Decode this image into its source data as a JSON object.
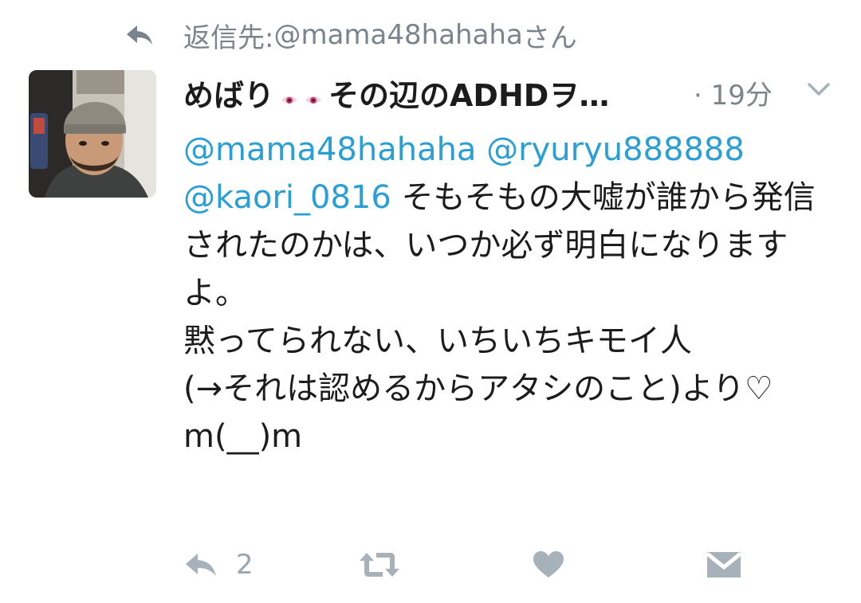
{
  "reply_context": {
    "label": "返信先: ",
    "handle": "@mama48hahaha",
    "suffix": "さん"
  },
  "tweet": {
    "display_name_before": "めばり",
    "display_name_after": "その辺のADHDヲ…",
    "timestamp": "· 19分",
    "mentions_line1": "@mama48hahaha @ryuryu888888",
    "mention_line2": "@kaori_0816",
    "body_after_mentions": " そもそもの大嘘が誰から発信されたのかは、いつか必ず明白になりますよ。\n黙ってられない、いちいちキモイ人\n(→それは認めるからアタシのこと)より♡\nm(__)m"
  },
  "actions": {
    "reply_count": "2"
  },
  "colors": {
    "text": "#1c1c1c",
    "muted": "#7b848c",
    "link": "#2a9fd6",
    "icon": "#a7b1b9"
  }
}
